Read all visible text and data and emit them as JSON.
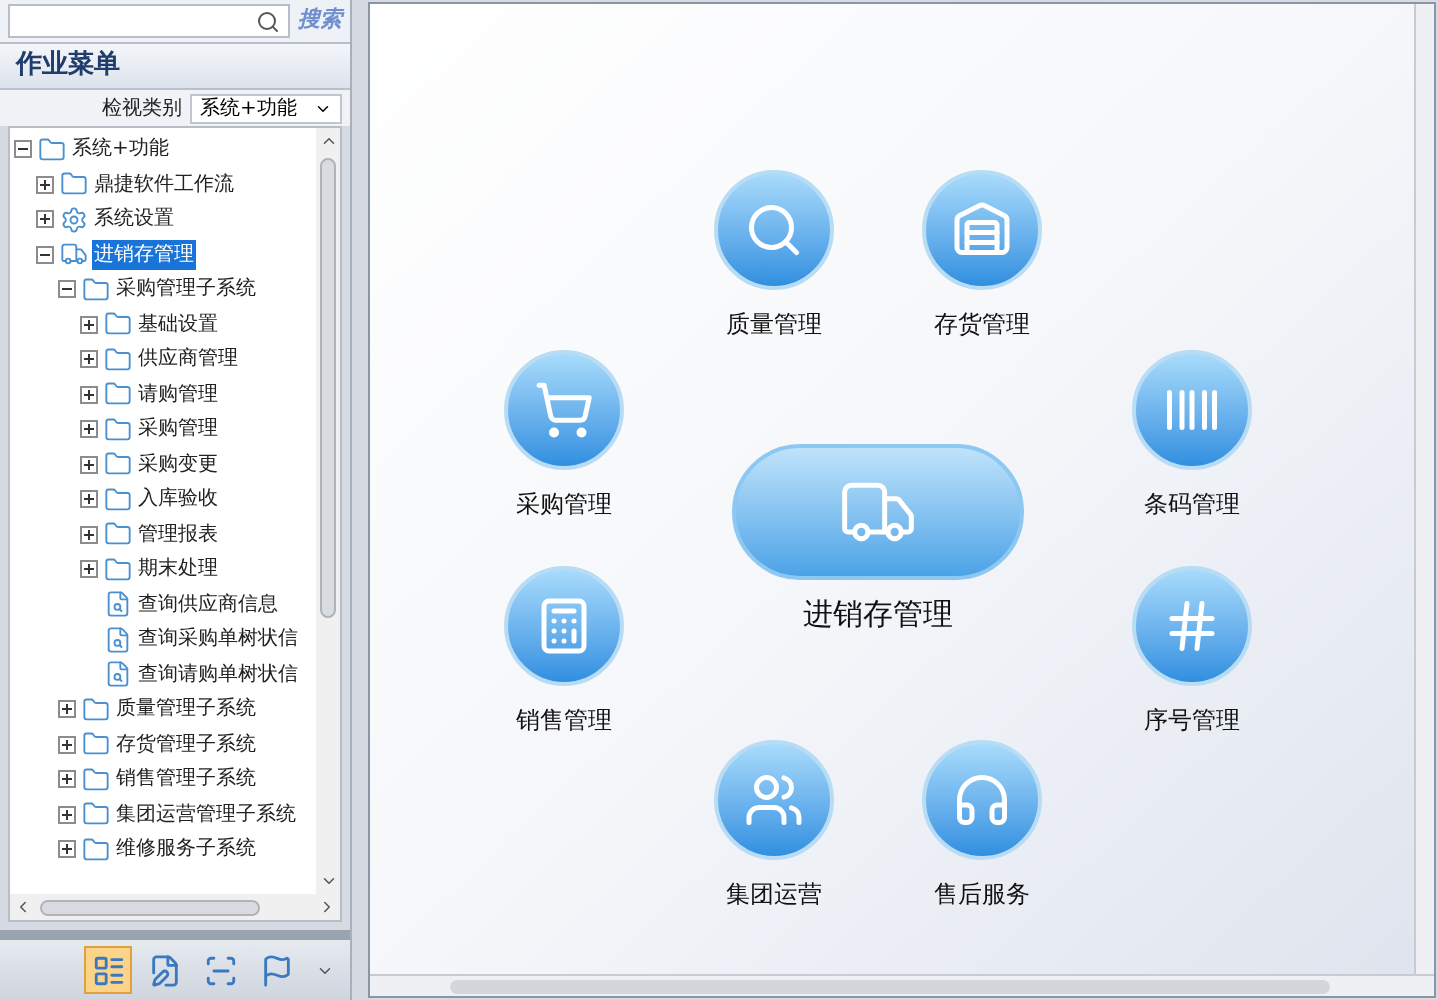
{
  "sidebar": {
    "search": {
      "logo_text": "搜索"
    },
    "title": "作业菜单",
    "filter": {
      "label": "检视类别",
      "value": "系统+功能"
    },
    "tree": [
      {
        "label": "系统+功能",
        "kind": "folder",
        "expanded": true,
        "selected": false,
        "children": [
          {
            "label": "鼎捷软件工作流",
            "kind": "folder",
            "expanded": false,
            "selected": false
          },
          {
            "label": "系统设置",
            "kind": "gear",
            "expanded": false,
            "selected": false
          },
          {
            "label": "进销存管理",
            "kind": "truck",
            "expanded": true,
            "selected": true,
            "children": [
              {
                "label": "采购管理子系统",
                "kind": "folder",
                "expanded": true,
                "selected": false,
                "children": [
                  {
                    "label": "基础设置",
                    "kind": "folder",
                    "expanded": false,
                    "selected": false
                  },
                  {
                    "label": "供应商管理",
                    "kind": "folder",
                    "expanded": false,
                    "selected": false
                  },
                  {
                    "label": "请购管理",
                    "kind": "folder",
                    "expanded": false,
                    "selected": false
                  },
                  {
                    "label": "采购管理",
                    "kind": "folder",
                    "expanded": false,
                    "selected": false
                  },
                  {
                    "label": "采购变更",
                    "kind": "folder",
                    "expanded": false,
                    "selected": false
                  },
                  {
                    "label": "入库验收",
                    "kind": "folder",
                    "expanded": false,
                    "selected": false
                  },
                  {
                    "label": "管理报表",
                    "kind": "folder",
                    "expanded": false,
                    "selected": false
                  },
                  {
                    "label": "期末处理",
                    "kind": "folder",
                    "expanded": false,
                    "selected": false
                  },
                  {
                    "label": "查询供应商信息",
                    "kind": "query",
                    "selected": false
                  },
                  {
                    "label": "查询采购单树状信",
                    "kind": "query",
                    "selected": false
                  },
                  {
                    "label": "查询请购单树状信",
                    "kind": "query",
                    "selected": false
                  }
                ]
              },
              {
                "label": "质量管理子系统",
                "kind": "folder",
                "expanded": false,
                "selected": false
              },
              {
                "label": "存货管理子系统",
                "kind": "folder",
                "expanded": false,
                "selected": false
              },
              {
                "label": "销售管理子系统",
                "kind": "folder",
                "expanded": false,
                "selected": false
              },
              {
                "label": "集团运营管理子系统",
                "kind": "folder",
                "expanded": false,
                "selected": false
              },
              {
                "label": "维修服务子系统",
                "kind": "folder",
                "expanded": false,
                "selected": false
              }
            ]
          }
        ]
      }
    ],
    "toolbar": [
      {
        "selected": true
      },
      {
        "selected": false
      },
      {
        "selected": false
      },
      {
        "selected": false
      }
    ]
  },
  "diagram": {
    "center": {
      "label": "进销存管理"
    },
    "nodes": [
      {
        "label": "质量管理"
      },
      {
        "label": "存货管理"
      },
      {
        "label": "采购管理"
      },
      {
        "label": "条码管理"
      },
      {
        "label": "销售管理"
      },
      {
        "label": "序号管理"
      },
      {
        "label": "集团运营"
      },
      {
        "label": "售后服务"
      }
    ]
  }
}
